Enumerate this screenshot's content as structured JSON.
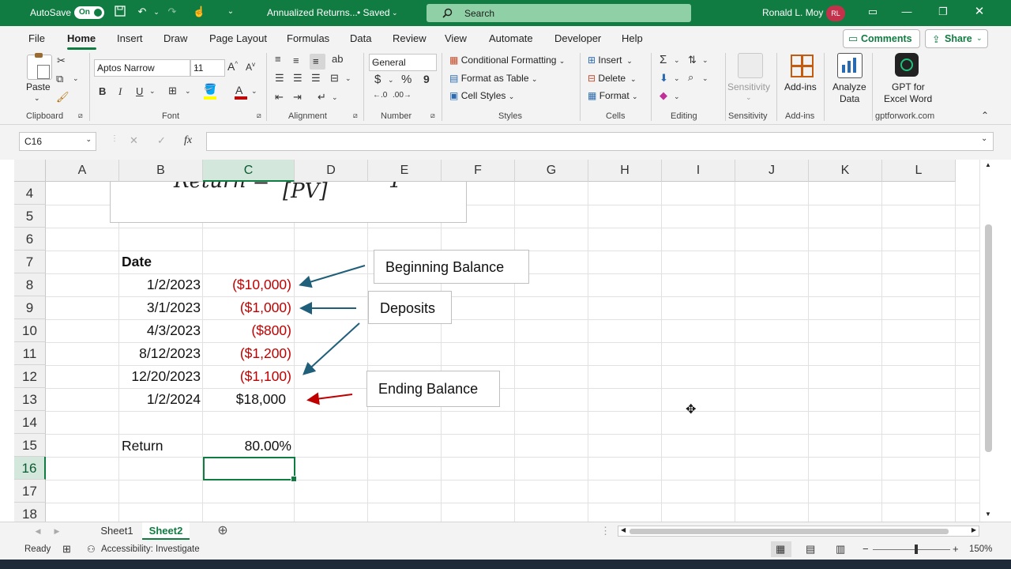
{
  "titlebar": {
    "autosave_label": "AutoSave",
    "autosave_state": "On",
    "file_title": "Annualized Returns...",
    "saved_status": "• Saved",
    "search_placeholder": "Search",
    "user_name": "Ronald L. Moy",
    "user_initials": "RL"
  },
  "menu": {
    "items": [
      "File",
      "Home",
      "Insert",
      "Draw",
      "Page Layout",
      "Formulas",
      "Data",
      "Review",
      "View",
      "Automate",
      "Developer",
      "Help"
    ],
    "comments_label": "Comments",
    "share_label": "Share"
  },
  "ribbon": {
    "clipboard": {
      "paste_label": "Paste",
      "group_label": "Clipboard"
    },
    "font": {
      "font_name": "Aptos Narrow",
      "font_size": "11",
      "group_label": "Font",
      "bold": "B",
      "italic": "I",
      "underline": "U"
    },
    "alignment": {
      "group_label": "Alignment"
    },
    "number": {
      "format": "General",
      "group_label": "Number",
      "currency": "$",
      "percent": "%",
      "comma": "9"
    },
    "styles": {
      "conditional": "Conditional Formatting",
      "format_table": "Format as Table",
      "cell_styles": "Cell Styles",
      "group_label": "Styles"
    },
    "cells": {
      "insert": "Insert",
      "delete": "Delete",
      "format": "Format",
      "group_label": "Cells"
    },
    "editing": {
      "group_label": "Editing"
    },
    "sensitivity": {
      "label": "Sensitivity",
      "group_label": "Sensitivity"
    },
    "addins": {
      "label": "Add-ins",
      "group_label": "Add-ins"
    },
    "analyze": {
      "label1": "Analyze",
      "label2": "Data"
    },
    "gpt": {
      "label1": "GPT for",
      "label2": "Excel Word",
      "group_label": "gptforwork.com"
    }
  },
  "formula_bar": {
    "name_box": "C16",
    "fx": "fx",
    "formula": ""
  },
  "grid": {
    "columns": [
      "A",
      "B",
      "C",
      "D",
      "E",
      "F",
      "G",
      "H",
      "I",
      "J",
      "K",
      "L"
    ],
    "rows": [
      "4",
      "5",
      "6",
      "7",
      "8",
      "9",
      "10",
      "11",
      "12",
      "13",
      "14",
      "15",
      "16",
      "17",
      "18"
    ],
    "formula_fragment": "[PV]",
    "date_header": "Date",
    "dates": [
      "1/2/2023",
      "3/1/2023",
      "4/3/2023",
      "8/12/2023",
      "12/20/2023",
      "1/2/2024"
    ],
    "amounts": [
      "($10,000)",
      "($1,000)",
      "($800)",
      "($1,200)",
      "($1,100)",
      "$18,000"
    ],
    "return_label": "Return",
    "return_value": "80.00%"
  },
  "callouts": {
    "beginning": "Beginning Balance",
    "deposits": "Deposits",
    "ending": "Ending Balance"
  },
  "tabs": {
    "sheet1": "Sheet1",
    "sheet2": "Sheet2"
  },
  "status": {
    "ready": "Ready",
    "accessibility": "Accessibility: Investigate",
    "zoom": "150%"
  },
  "colors": {
    "accent": "#107c41",
    "negative": "#c00000",
    "arrow_blue": "#1f5f7a",
    "arrow_red": "#c00000"
  }
}
